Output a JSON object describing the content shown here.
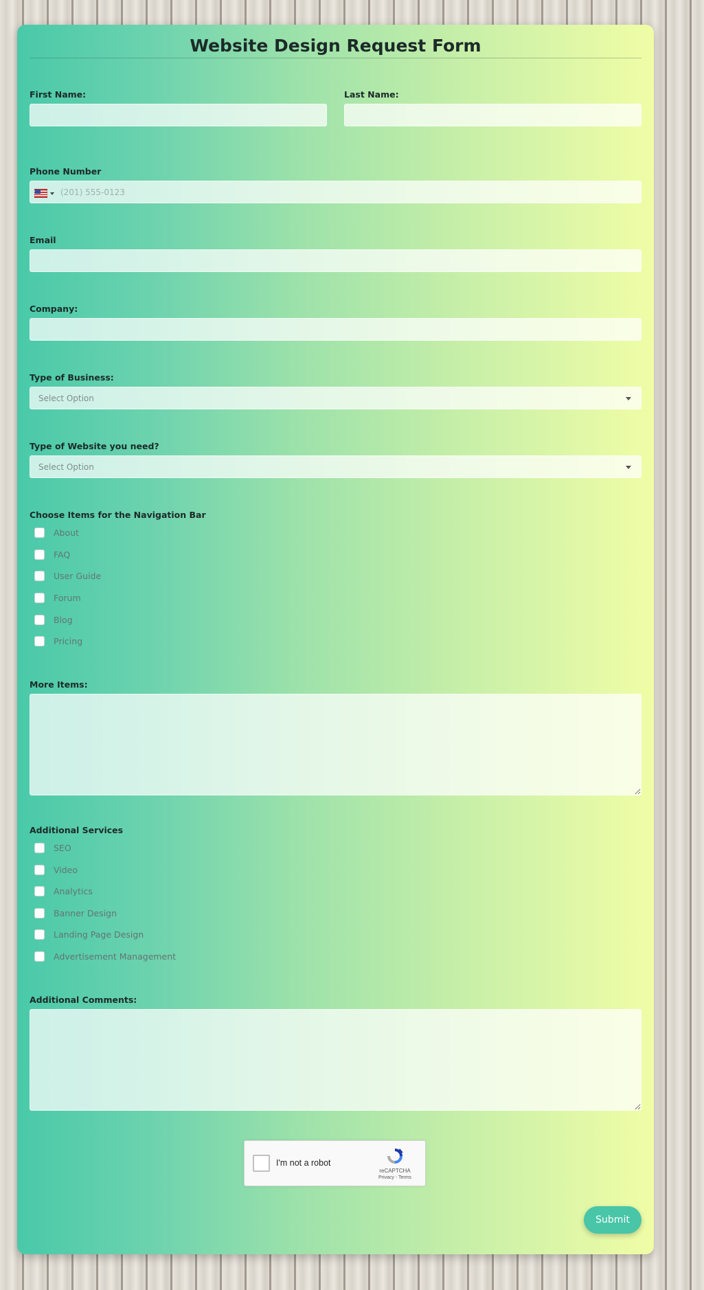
{
  "form": {
    "title": "Website Design Request Form",
    "first_name": {
      "label": "First Name:",
      "value": "",
      "placeholder": ""
    },
    "last_name": {
      "label": "Last Name:",
      "value": "",
      "placeholder": ""
    },
    "phone": {
      "label": "Phone Number",
      "country_flag_icon": "us-flag-icon",
      "placeholder": "(201) 555-0123",
      "value": ""
    },
    "email": {
      "label": "Email",
      "value": ""
    },
    "company": {
      "label": "Company:",
      "value": ""
    },
    "business_type": {
      "label": "Type of Business:",
      "selected": "Select Option"
    },
    "website_type": {
      "label": "Type of Website you need?",
      "selected": "Select Option"
    },
    "nav_items": {
      "label": "Choose Items for the Navigation Bar",
      "options": [
        "About",
        "FAQ",
        "User Guide",
        "Forum",
        "Blog",
        "Pricing"
      ]
    },
    "more_items": {
      "label": "More Items:",
      "value": ""
    },
    "additional_services": {
      "label": "Additional Services",
      "options": [
        "SEO",
        "Video",
        "Analytics",
        "Banner Design",
        "Landing Page Design",
        "Advertisement Management"
      ]
    },
    "comments": {
      "label": "Additional Comments:",
      "value": ""
    },
    "captcha": {
      "checkbox_label": "I'm not a robot",
      "brand": "reCAPTCHA",
      "links": "Privacy - Terms"
    },
    "submit_label": "Submit"
  },
  "colors": {
    "gradient_start": "#49c9a9",
    "gradient_end": "#f0fda6",
    "submit_bg": "#48c6a7",
    "text_dark": "#1c2a28"
  }
}
